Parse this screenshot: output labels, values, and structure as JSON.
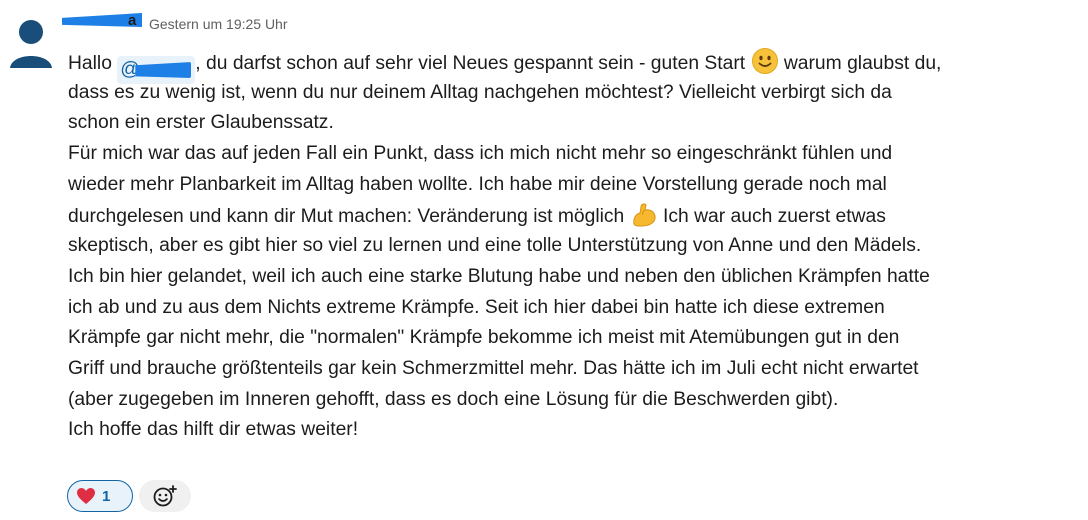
{
  "message": {
    "author_name_visible": "a",
    "timestamp": "Gestern um 19:25 Uhr",
    "mention_prefix": "@",
    "lines": [
      "Hallo ",
      ", du darfst schon auf sehr viel Neues gespannt sein - guten Start ",
      " warum glaubst du,",
      "dass es zu wenig ist, wenn du nur deinem Alltag nachgehen möchtest?  Vielleicht verbirgt sich da",
      "schon ein erster Glaubenssatz.",
      "Für mich war das auf jeden Fall ein Punkt, dass ich mich nicht mehr so eingeschränkt fühlen und",
      "wieder mehr Planbarkeit im Alltag haben wollte. Ich habe mir deine Vorstellung gerade noch mal",
      "durchgelesen und kann dir Mut machen: Veränderung ist möglich ",
      " Ich war auch zuerst etwas",
      "skeptisch, aber es gibt hier so viel zu lernen und eine tolle Unterstützung von Anne und den Mädels.",
      "Ich bin hier gelandet, weil ich auch eine starke Blutung habe und neben den üblichen Krämpfen hatte",
      "ich ab und zu aus dem Nichts extreme Krämpfe. Seit ich hier dabei bin hatte ich diese extremen",
      "Krämpfe gar nicht mehr, die \"normalen\" Krämpfe bekomme ich meist mit Atemübungen gut in den",
      "Griff und brauche größtenteils gar kein Schmerzmittel mehr. Das hätte ich im Juli echt nicht erwartet",
      "(aber zugegeben im Inneren gehofft, dass es doch eine Lösung für die Beschwerden gibt).",
      "Ich hoffe das hilft dir etwas weiter!"
    ]
  },
  "reactions": [
    {
      "emoji": "heart-emoji",
      "count": "1"
    }
  ],
  "icons": {
    "avatar": "user-avatar-icon",
    "smile": "slightly-smiling-face-emoji",
    "muscle": "flexed-biceps-emoji",
    "add_reaction": "add-reaction-icon"
  },
  "colors": {
    "mention_bg": "#e8f2fb",
    "link": "#1264a3",
    "avatar": "#1a4e7a"
  }
}
